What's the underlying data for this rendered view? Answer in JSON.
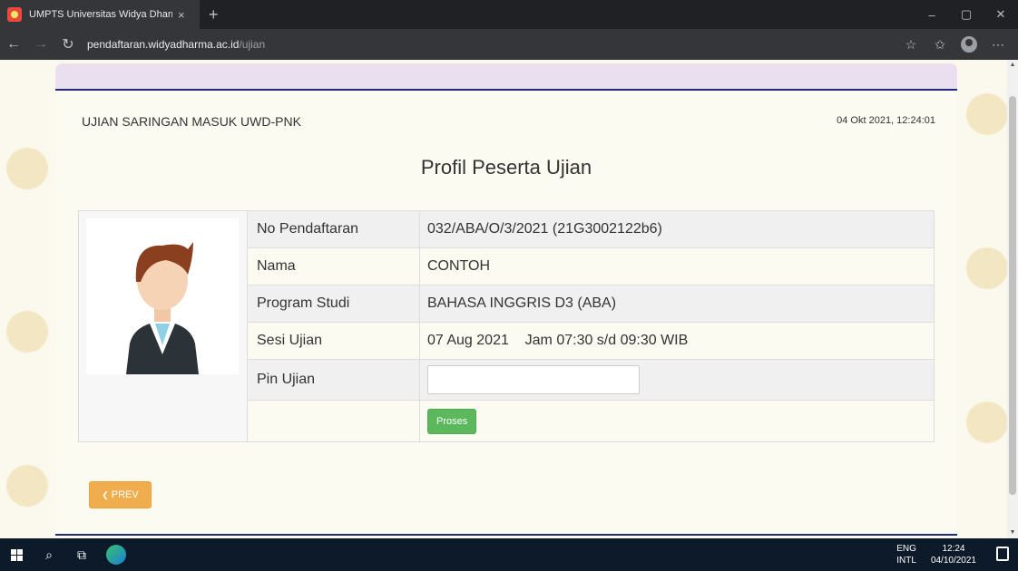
{
  "browser": {
    "tab_title": "UMPTS Universitas Widya Dharm",
    "tab_close": "×",
    "new_tab": "+",
    "url_host": "pendaftaran.widyadharma.ac.id",
    "url_path": "/ujian",
    "window_controls": {
      "minimize": "–",
      "maximize": "▢",
      "close": "✕"
    }
  },
  "page": {
    "exam_title": "UJIAN SARINGAN MASUK UWD-PNK",
    "datetime": "04 Okt 2021, 12:24:01",
    "heading": "Profil Peserta Ujian",
    "rows": [
      {
        "label": "No Pendaftaran",
        "value": "032/ABA/O/3/2021 (21G3002122b6)"
      },
      {
        "label": "Nama",
        "value": "CONTOH"
      },
      {
        "label": "Program Studi",
        "value": "BAHASA INGGRIS D3 (ABA)"
      },
      {
        "label": "Sesi Ujian",
        "value": "07 Aug 2021    Jam 07:30 s/d 09:30 WIB"
      },
      {
        "label": "Pin Ujian",
        "value": ""
      }
    ],
    "pin_placeholder": "",
    "proses_label": "Proses",
    "prev_label": "PREV",
    "prev_icon": "❮"
  },
  "taskbar": {
    "lang_line1": "ENG",
    "lang_line2": "INTL",
    "time": "12:24",
    "date": "04/10/2021"
  },
  "colors": {
    "accent_blue": "#1f2a7a",
    "proses_green": "#5cb85c",
    "prev_orange": "#f0ad4e"
  }
}
